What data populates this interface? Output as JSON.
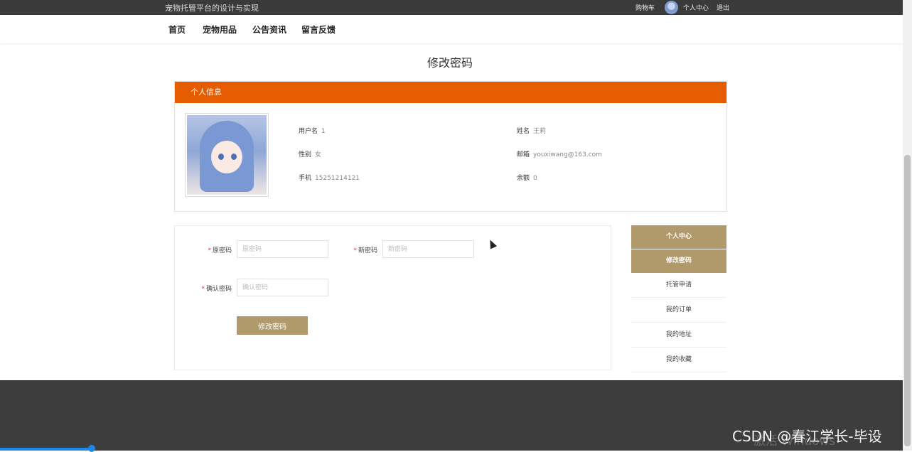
{
  "site": {
    "title": "宠物托管平台的设计与实现"
  },
  "topbar": {
    "cart": "购物车",
    "user_center": "个人中心",
    "logout": "退出"
  },
  "nav": {
    "items": [
      "首页",
      "宠物用品",
      "公告资讯",
      "留言反馈"
    ]
  },
  "page": {
    "title": "修改密码"
  },
  "profile": {
    "header": "个人信息",
    "username_label": "用户名",
    "username": "1",
    "name_label": "姓名",
    "name": "王莉",
    "gender_label": "性别",
    "gender": "女",
    "email_label": "邮箱",
    "email": "youxiwang@163.com",
    "phone_label": "手机",
    "phone": "15251214121",
    "balance_label": "余额",
    "balance": "0"
  },
  "form": {
    "old_label": "原密码",
    "old_placeholder": "原密码",
    "new_label": "新密码",
    "new_placeholder": "新密码",
    "confirm_label": "确认密码",
    "confirm_placeholder": "确认密码",
    "submit": "修改密码",
    "required_mark": "*"
  },
  "side_menu": {
    "items": [
      "个人中心",
      "修改密码",
      "托管申请",
      "我的订单",
      "我的地址",
      "我的收藏"
    ],
    "active": [
      0,
      1
    ]
  },
  "overlay": {
    "watermark": "CSDN @春江学长-毕设",
    "windows_activation": "激活 Windows"
  },
  "colors": {
    "accent_orange": "#e65c00",
    "button_tan": "#b09a6c",
    "topbar": "#3a3a3a",
    "footer": "#3d3d3d"
  }
}
